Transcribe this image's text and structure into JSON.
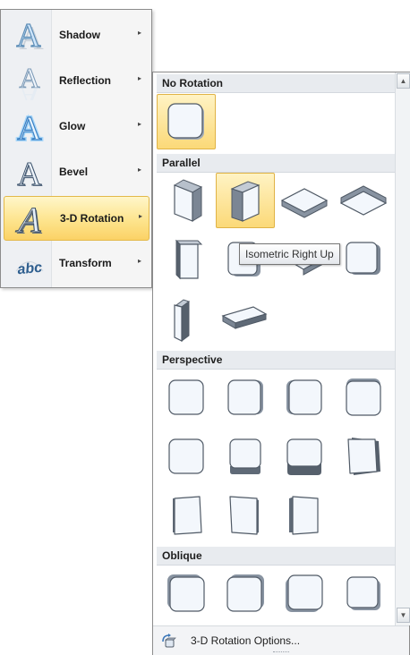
{
  "menu": {
    "items": [
      {
        "label": "Shadow"
      },
      {
        "label": "Reflection"
      },
      {
        "label": "Glow"
      },
      {
        "label": "Bevel"
      },
      {
        "label": "3-D Rotation"
      },
      {
        "label": "Transform"
      }
    ],
    "arrow": "▸"
  },
  "gallery": {
    "sections": [
      {
        "title": "No Rotation"
      },
      {
        "title": "Parallel"
      },
      {
        "title": "Perspective"
      },
      {
        "title": "Oblique"
      }
    ],
    "tooltip": "Isometric Right Up",
    "footer_label": "3-D Rotation Options...",
    "scroll_up": "▲",
    "scroll_down": "▼"
  },
  "colors": {
    "highlight": "#fde48d",
    "face": "#eef3fb",
    "side": "#9aa4b1",
    "edge": "#4f5964"
  }
}
